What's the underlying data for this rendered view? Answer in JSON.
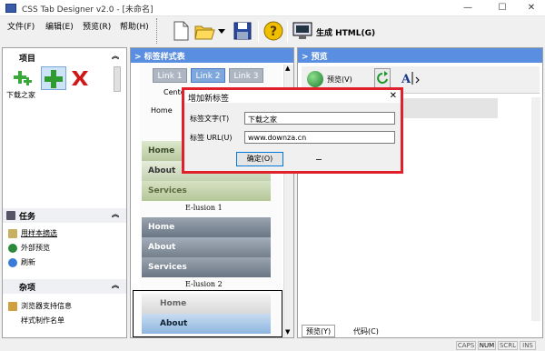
{
  "window": {
    "title": "CSS Tab Designer v2.0 - [未命名]"
  },
  "menu": {
    "items": [
      "文件(F)",
      "编辑(E)",
      "预览(R)",
      "帮助(H)"
    ]
  },
  "toolbar": {
    "generate_label": "生成 HTML(G)"
  },
  "left": {
    "project_header": "项目",
    "project_item": "下载之家",
    "tasks_header": "任务",
    "tasks": [
      "用样本摘选",
      "外部预览",
      "刷新"
    ],
    "misc_header": "杂项",
    "misc": [
      "浏览器支持信息",
      "样式制作名单"
    ]
  },
  "middle": {
    "header": "> 标签样式表",
    "tabs": [
      "Link 1",
      "Link 2",
      "Link 3"
    ],
    "center_text": "Cente",
    "home_text": "Home",
    "preset1": {
      "items": [
        "Home",
        "About",
        "Services"
      ],
      "caption": "E-lusion 1"
    },
    "preset2": {
      "items": [
        "Home",
        "About",
        "Services"
      ],
      "caption": "E-lusion 2"
    },
    "preset3": {
      "items": [
        "Home",
        "About"
      ]
    }
  },
  "right": {
    "header": "> 预览",
    "preview_btn": "预览(V)",
    "bottom_tabs": [
      "预览(Y)",
      "代码(C)"
    ]
  },
  "dialog": {
    "title": "增加新标签",
    "label_text_label": "标签文字(T)",
    "label_text_value": "下载之家",
    "url_label": "标签 URL(U)",
    "url_value": "www.downza.cn",
    "ok_label": "确定(O)"
  },
  "status": [
    "CAPS",
    "NUM",
    "SCRL",
    "INS"
  ]
}
